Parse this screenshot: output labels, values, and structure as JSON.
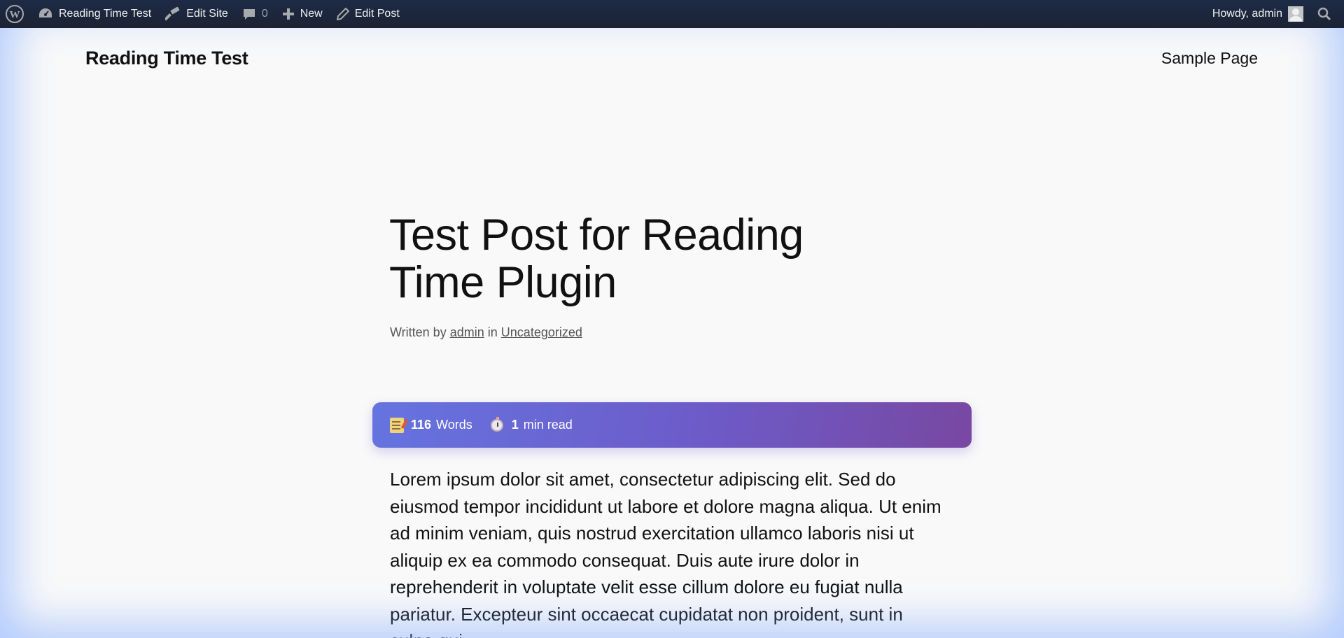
{
  "admin_bar": {
    "site_name": "Reading Time Test",
    "edit_site": "Edit Site",
    "comments_count": "0",
    "new_label": "New",
    "edit_post": "Edit Post",
    "greeting": "Howdy, admin"
  },
  "header": {
    "site_title": "Reading Time Test",
    "nav_items": [
      "Sample Page"
    ]
  },
  "post": {
    "title": "Test Post for Reading Time Plugin",
    "meta_prefix": "Written by",
    "author": "admin",
    "meta_in": "in",
    "category": "Uncategorized",
    "reading_time": {
      "word_count": "116",
      "words_label": "Words",
      "minutes": "1",
      "minutes_label": "min read"
    },
    "body": "Lorem ipsum dolor sit amet, consectetur adipiscing elit. Sed do eiusmod tempor incididunt ut labore et dolore magna aliqua. Ut enim ad minim veniam, quis nostrud exercitation ullamco laboris nisi ut aliquip ex ea commodo consequat. Duis aute irure dolor in reprehenderit in voluptate velit esse cillum dolore eu fugiat nulla pariatur. Excepteur sint occaecat cupidatat non proident, sunt in culpa qui"
  },
  "icons": [
    "wordpress-logo-icon",
    "dashboard-icon",
    "hammer-icon",
    "comment-icon",
    "plus-icon",
    "pencil-icon",
    "avatar",
    "search-icon",
    "memo-icon",
    "stopwatch-icon"
  ],
  "colors": {
    "admin_bar": "#1d2327",
    "reading_box_start": "#6574e0",
    "reading_box_end": "#7848a2",
    "page_bg": "#f9f9f9"
  }
}
